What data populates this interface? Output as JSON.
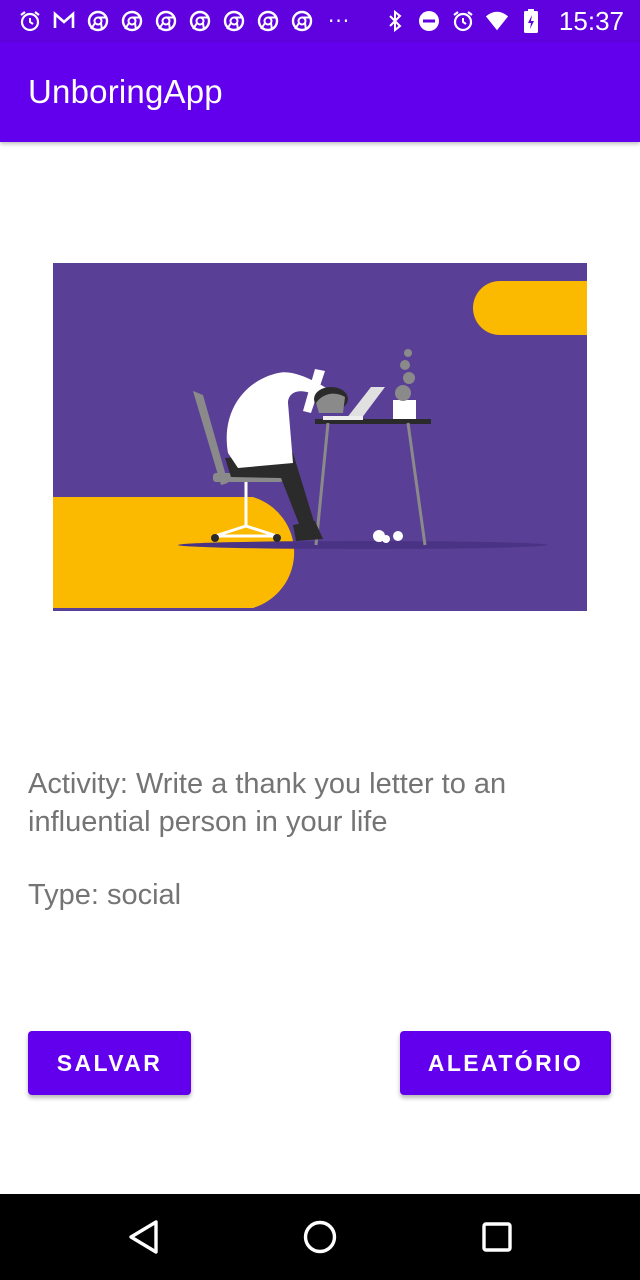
{
  "status_bar": {
    "time": "15:37",
    "left_icons": [
      "alarm-icon",
      "gmail-icon",
      "chrome-icon",
      "chrome-icon",
      "chrome-icon",
      "chrome-icon",
      "chrome-icon",
      "chrome-icon",
      "chrome-icon"
    ],
    "overflow": "···",
    "right_icons": [
      "bluetooth-icon",
      "do-not-disturb-icon",
      "alarm-icon",
      "wifi-icon",
      "battery-charging-icon"
    ]
  },
  "app_bar": {
    "title": "UnboringApp"
  },
  "content": {
    "activity": "Activity: Write a thank you letter to an influential person in your life",
    "type": "Type: social"
  },
  "buttons": {
    "save": "SALVAR",
    "random": "ALEATÓRIO"
  },
  "colors": {
    "primary": "#6200ee",
    "primary_dark": "#5f02df",
    "illustration_bg": "#5a3f96",
    "illustration_accent": "#fbb900",
    "text": "#747474"
  },
  "nav_bar": {
    "icons": [
      "back-icon",
      "home-icon",
      "recents-icon"
    ]
  }
}
